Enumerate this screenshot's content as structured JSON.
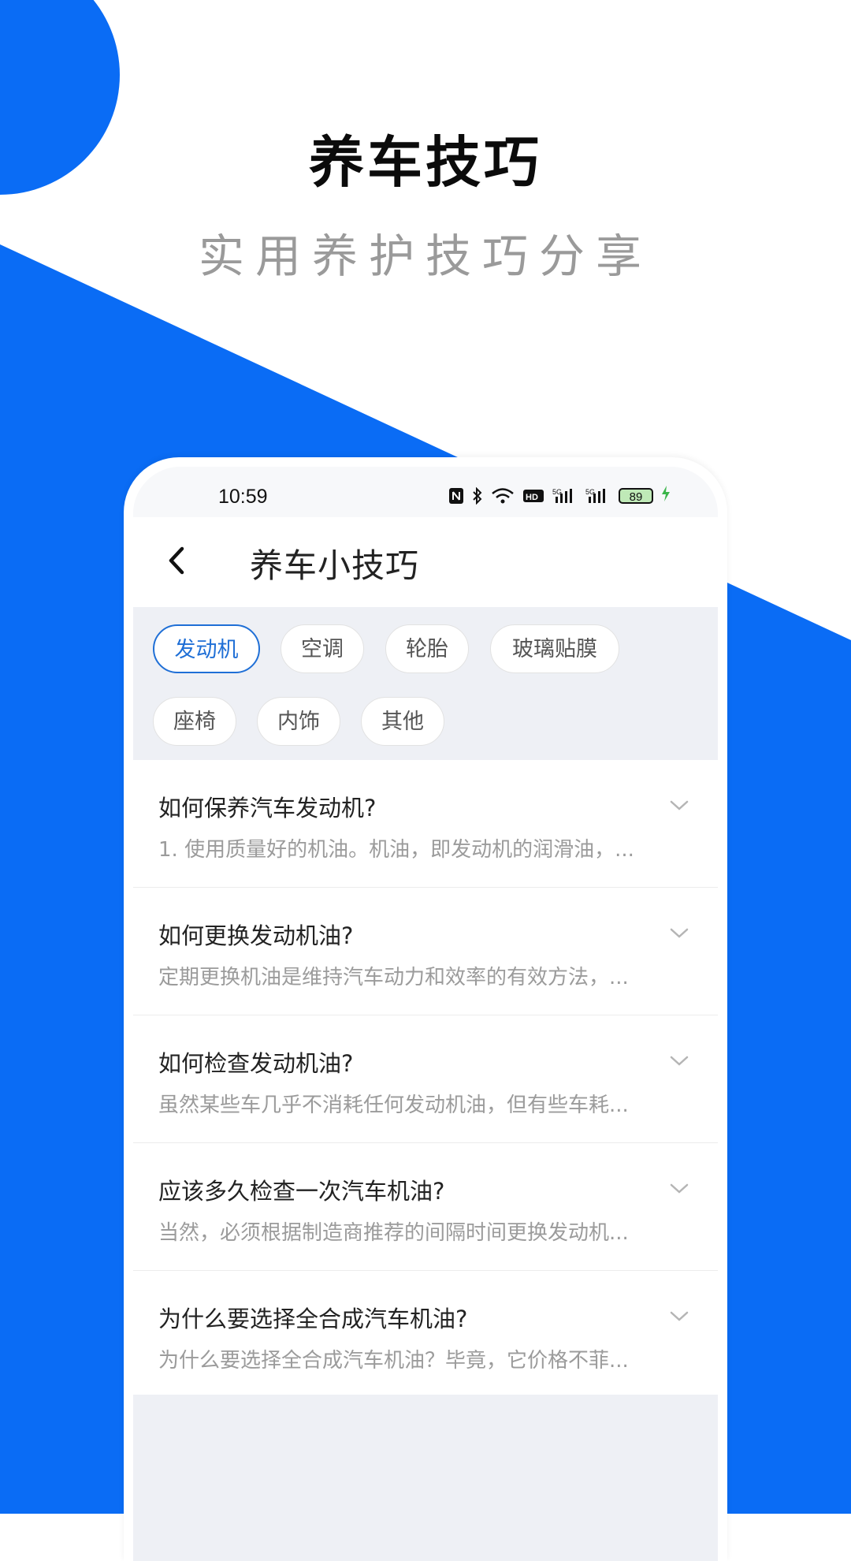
{
  "hero": {
    "title": "养车技巧",
    "subtitle": "实用养护技巧分享"
  },
  "status_bar": {
    "time": "10:59",
    "icons": [
      "nfc-icon",
      "bluetooth-icon",
      "wifi-icon",
      "hd-icon",
      "signal-5g-icon",
      "signal-5g-icon"
    ],
    "battery": "89"
  },
  "navbar": {
    "back_icon": "chevron-left-icon",
    "title": "养车小技巧"
  },
  "categories": [
    {
      "label": "发动机",
      "active": true
    },
    {
      "label": "空调",
      "active": false
    },
    {
      "label": "轮胎",
      "active": false
    },
    {
      "label": "玻璃贴膜",
      "active": false
    },
    {
      "label": "座椅",
      "active": false
    },
    {
      "label": "内饰",
      "active": false
    },
    {
      "label": "其他",
      "active": false
    }
  ],
  "faq": [
    {
      "question": "如何保养汽车发动机?",
      "preview": "1. 使用质量好的机油。机油，即发动机的润滑油，..."
    },
    {
      "question": "如何更换发动机油?",
      "preview": "定期更换机油是维持汽车动力和效率的有效方法，..."
    },
    {
      "question": "如何检查发动机油?",
      "preview": "虽然某些车几乎不消耗任何发动机油，但有些车耗..."
    },
    {
      "question": "应该多久检查一次汽车机油?",
      "preview": "当然，必须根据制造商推荐的间隔时间更换发动机..."
    },
    {
      "question": "为什么要选择全合成汽车机油?",
      "preview": "为什么要选择全合成汽车机油？毕竟，它价格不菲..."
    }
  ],
  "colors": {
    "brand_blue": "#0a6cf5",
    "chip_active": "#1f6fd6"
  }
}
